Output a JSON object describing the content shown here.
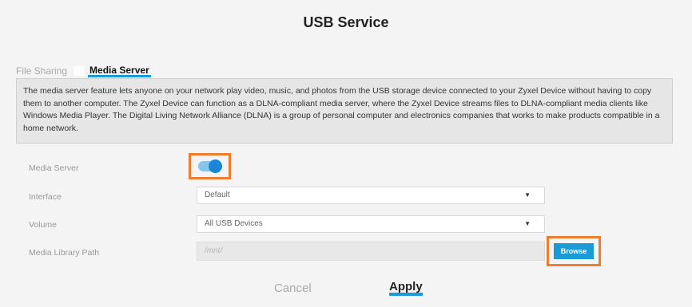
{
  "page": {
    "title": "USB Service"
  },
  "tabs": [
    {
      "label": "File Sharing",
      "active": false
    },
    {
      "label": "Media Server",
      "active": true
    }
  ],
  "description": "The media server feature lets anyone on your network play video, music, and photos from the USB storage device connected to your Zyxel Device without having to copy them to another computer. The Zyxel Device can function as a DLNA-compliant media server, where the Zyxel Device streams files to DLNA-compliant media clients like Windows Media Player. The Digital Living Network Alliance (DLNA) is a group of personal computer and electronics companies that works to make products compatible in a home network.",
  "form": {
    "media_server": {
      "label": "Media Server",
      "enabled": true
    },
    "interface": {
      "label": "Interface",
      "value": "Default"
    },
    "volume": {
      "label": "Volume",
      "value": "All USB Devices"
    },
    "media_library_path": {
      "label": "Media Library Path",
      "value": "/mnt/",
      "browse_label": "Browse"
    }
  },
  "actions": {
    "cancel_label": "Cancel",
    "apply_label": "Apply"
  },
  "colors": {
    "accent": "#1a9bd7",
    "highlight_frame": "#ee7d2d",
    "toggle_on": "#1a86d9"
  }
}
